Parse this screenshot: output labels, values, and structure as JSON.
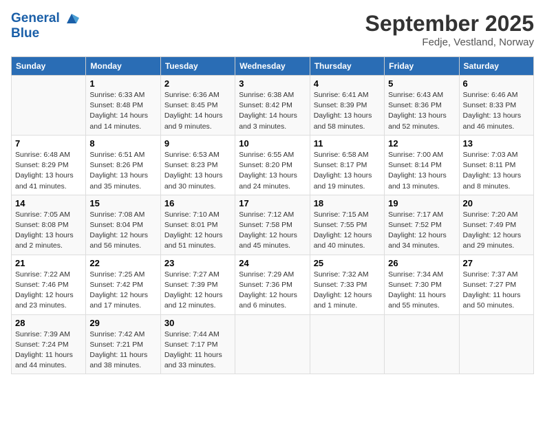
{
  "logo": {
    "line1": "General",
    "line2": "Blue"
  },
  "title": "September 2025",
  "subtitle": "Fedje, Vestland, Norway",
  "days_of_week": [
    "Sunday",
    "Monday",
    "Tuesday",
    "Wednesday",
    "Thursday",
    "Friday",
    "Saturday"
  ],
  "weeks": [
    [
      {
        "day": "",
        "sunrise": "",
        "sunset": "",
        "daylight": ""
      },
      {
        "day": "1",
        "sunrise": "Sunrise: 6:33 AM",
        "sunset": "Sunset: 8:48 PM",
        "daylight": "Daylight: 14 hours and 14 minutes."
      },
      {
        "day": "2",
        "sunrise": "Sunrise: 6:36 AM",
        "sunset": "Sunset: 8:45 PM",
        "daylight": "Daylight: 14 hours and 9 minutes."
      },
      {
        "day": "3",
        "sunrise": "Sunrise: 6:38 AM",
        "sunset": "Sunset: 8:42 PM",
        "daylight": "Daylight: 14 hours and 3 minutes."
      },
      {
        "day": "4",
        "sunrise": "Sunrise: 6:41 AM",
        "sunset": "Sunset: 8:39 PM",
        "daylight": "Daylight: 13 hours and 58 minutes."
      },
      {
        "day": "5",
        "sunrise": "Sunrise: 6:43 AM",
        "sunset": "Sunset: 8:36 PM",
        "daylight": "Daylight: 13 hours and 52 minutes."
      },
      {
        "day": "6",
        "sunrise": "Sunrise: 6:46 AM",
        "sunset": "Sunset: 8:33 PM",
        "daylight": "Daylight: 13 hours and 46 minutes."
      }
    ],
    [
      {
        "day": "7",
        "sunrise": "Sunrise: 6:48 AM",
        "sunset": "Sunset: 8:29 PM",
        "daylight": "Daylight: 13 hours and 41 minutes."
      },
      {
        "day": "8",
        "sunrise": "Sunrise: 6:51 AM",
        "sunset": "Sunset: 8:26 PM",
        "daylight": "Daylight: 13 hours and 35 minutes."
      },
      {
        "day": "9",
        "sunrise": "Sunrise: 6:53 AM",
        "sunset": "Sunset: 8:23 PM",
        "daylight": "Daylight: 13 hours and 30 minutes."
      },
      {
        "day": "10",
        "sunrise": "Sunrise: 6:55 AM",
        "sunset": "Sunset: 8:20 PM",
        "daylight": "Daylight: 13 hours and 24 minutes."
      },
      {
        "day": "11",
        "sunrise": "Sunrise: 6:58 AM",
        "sunset": "Sunset: 8:17 PM",
        "daylight": "Daylight: 13 hours and 19 minutes."
      },
      {
        "day": "12",
        "sunrise": "Sunrise: 7:00 AM",
        "sunset": "Sunset: 8:14 PM",
        "daylight": "Daylight: 13 hours and 13 minutes."
      },
      {
        "day": "13",
        "sunrise": "Sunrise: 7:03 AM",
        "sunset": "Sunset: 8:11 PM",
        "daylight": "Daylight: 13 hours and 8 minutes."
      }
    ],
    [
      {
        "day": "14",
        "sunrise": "Sunrise: 7:05 AM",
        "sunset": "Sunset: 8:08 PM",
        "daylight": "Daylight: 13 hours and 2 minutes."
      },
      {
        "day": "15",
        "sunrise": "Sunrise: 7:08 AM",
        "sunset": "Sunset: 8:04 PM",
        "daylight": "Daylight: 12 hours and 56 minutes."
      },
      {
        "day": "16",
        "sunrise": "Sunrise: 7:10 AM",
        "sunset": "Sunset: 8:01 PM",
        "daylight": "Daylight: 12 hours and 51 minutes."
      },
      {
        "day": "17",
        "sunrise": "Sunrise: 7:12 AM",
        "sunset": "Sunset: 7:58 PM",
        "daylight": "Daylight: 12 hours and 45 minutes."
      },
      {
        "day": "18",
        "sunrise": "Sunrise: 7:15 AM",
        "sunset": "Sunset: 7:55 PM",
        "daylight": "Daylight: 12 hours and 40 minutes."
      },
      {
        "day": "19",
        "sunrise": "Sunrise: 7:17 AM",
        "sunset": "Sunset: 7:52 PM",
        "daylight": "Daylight: 12 hours and 34 minutes."
      },
      {
        "day": "20",
        "sunrise": "Sunrise: 7:20 AM",
        "sunset": "Sunset: 7:49 PM",
        "daylight": "Daylight: 12 hours and 29 minutes."
      }
    ],
    [
      {
        "day": "21",
        "sunrise": "Sunrise: 7:22 AM",
        "sunset": "Sunset: 7:46 PM",
        "daylight": "Daylight: 12 hours and 23 minutes."
      },
      {
        "day": "22",
        "sunrise": "Sunrise: 7:25 AM",
        "sunset": "Sunset: 7:42 PM",
        "daylight": "Daylight: 12 hours and 17 minutes."
      },
      {
        "day": "23",
        "sunrise": "Sunrise: 7:27 AM",
        "sunset": "Sunset: 7:39 PM",
        "daylight": "Daylight: 12 hours and 12 minutes."
      },
      {
        "day": "24",
        "sunrise": "Sunrise: 7:29 AM",
        "sunset": "Sunset: 7:36 PM",
        "daylight": "Daylight: 12 hours and 6 minutes."
      },
      {
        "day": "25",
        "sunrise": "Sunrise: 7:32 AM",
        "sunset": "Sunset: 7:33 PM",
        "daylight": "Daylight: 12 hours and 1 minute."
      },
      {
        "day": "26",
        "sunrise": "Sunrise: 7:34 AM",
        "sunset": "Sunset: 7:30 PM",
        "daylight": "Daylight: 11 hours and 55 minutes."
      },
      {
        "day": "27",
        "sunrise": "Sunrise: 7:37 AM",
        "sunset": "Sunset: 7:27 PM",
        "daylight": "Daylight: 11 hours and 50 minutes."
      }
    ],
    [
      {
        "day": "28",
        "sunrise": "Sunrise: 7:39 AM",
        "sunset": "Sunset: 7:24 PM",
        "daylight": "Daylight: 11 hours and 44 minutes."
      },
      {
        "day": "29",
        "sunrise": "Sunrise: 7:42 AM",
        "sunset": "Sunset: 7:21 PM",
        "daylight": "Daylight: 11 hours and 38 minutes."
      },
      {
        "day": "30",
        "sunrise": "Sunrise: 7:44 AM",
        "sunset": "Sunset: 7:17 PM",
        "daylight": "Daylight: 11 hours and 33 minutes."
      },
      {
        "day": "",
        "sunrise": "",
        "sunset": "",
        "daylight": ""
      },
      {
        "day": "",
        "sunrise": "",
        "sunset": "",
        "daylight": ""
      },
      {
        "day": "",
        "sunrise": "",
        "sunset": "",
        "daylight": ""
      },
      {
        "day": "",
        "sunrise": "",
        "sunset": "",
        "daylight": ""
      }
    ]
  ]
}
